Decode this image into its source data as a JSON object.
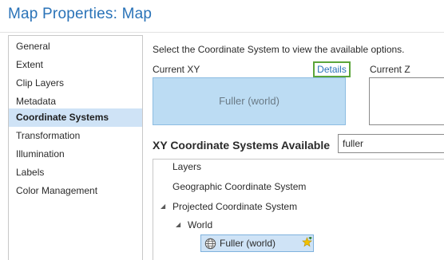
{
  "window": {
    "title": "Map Properties: Map"
  },
  "sidebar": {
    "items": [
      {
        "label": "General",
        "active": false
      },
      {
        "label": "Extent",
        "active": false
      },
      {
        "label": "Clip Layers",
        "active": false
      },
      {
        "label": "Metadata",
        "active": false
      },
      {
        "label": "Coordinate Systems",
        "active": true
      },
      {
        "label": "Transformation",
        "active": false
      },
      {
        "label": "Illumination",
        "active": false
      },
      {
        "label": "Labels",
        "active": false
      },
      {
        "label": "Color Management",
        "active": false
      }
    ]
  },
  "main": {
    "instruction": "Select the Coordinate System to view the available options.",
    "current_xy_label": "Current XY",
    "details_label": "Details",
    "current_xy_value": "Fuller (world)",
    "current_z_label": "Current Z",
    "available_heading": "XY Coordinate Systems Available",
    "search": {
      "value": "fuller",
      "placeholder": ""
    },
    "tree": [
      {
        "label": "Layers",
        "expanded": null,
        "level": 0
      },
      {
        "label": "Geographic Coordinate System",
        "expanded": null,
        "level": 0
      },
      {
        "label": "Projected Coordinate System",
        "expanded": true,
        "level": 0
      },
      {
        "label": "World",
        "expanded": true,
        "level": 1
      },
      {
        "label": "Fuller (world)",
        "selected": true,
        "level": 2,
        "icon": "globe-icon",
        "badge_icon": "favorite-star-icon"
      }
    ]
  },
  "colors": {
    "title": "#2a73b8",
    "selection": "#cfe3f6",
    "current_box": "#bcdcf3",
    "details_outline": "#5ba53a"
  }
}
